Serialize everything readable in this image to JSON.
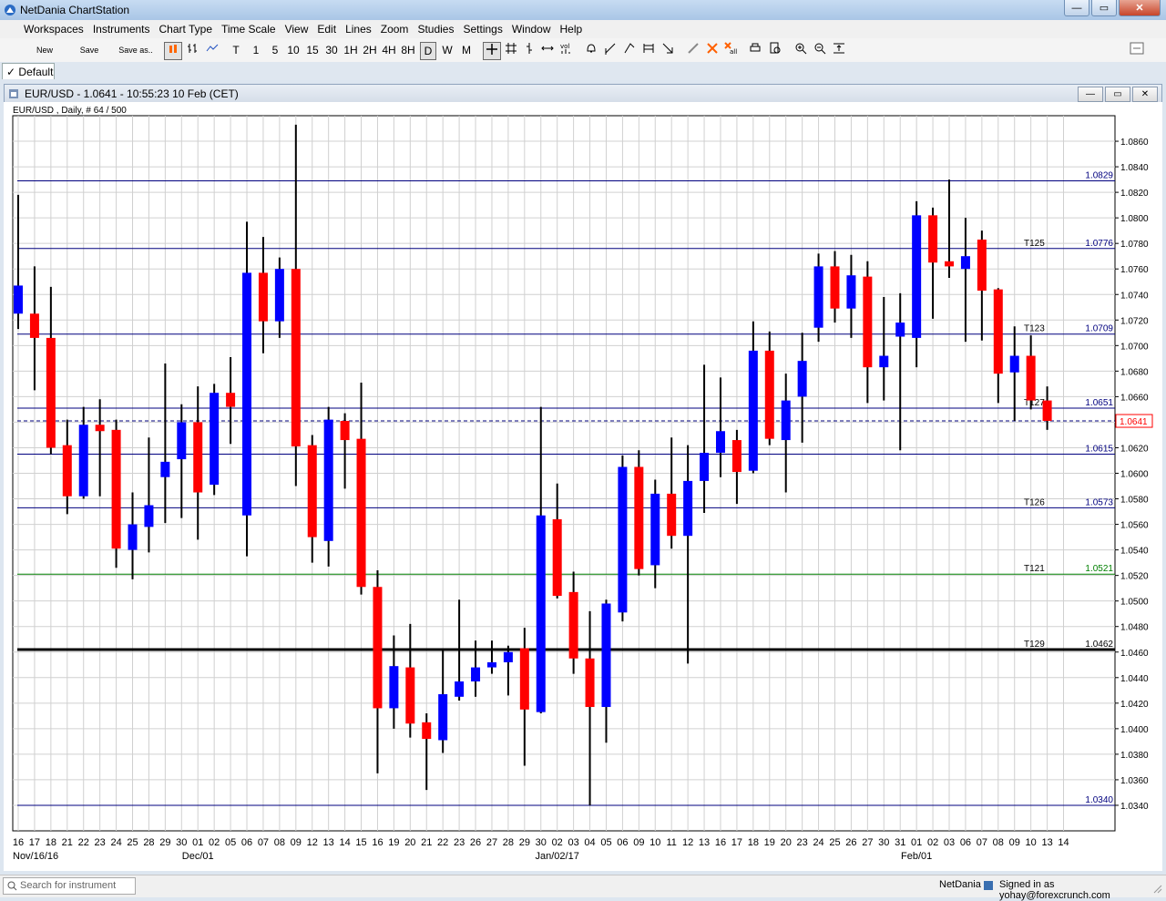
{
  "app": {
    "title": "NetDania ChartStation"
  },
  "window_buttons": [
    "—",
    "▭",
    "✕"
  ],
  "menu": [
    "Workspaces",
    "Instruments",
    "Chart Type",
    "Time Scale",
    "View",
    "Edit",
    "Lines",
    "Zoom",
    "Studies",
    "Settings",
    "Window",
    "Help"
  ],
  "toolbar": {
    "new": "New",
    "save": "Save",
    "save_as": "Save as..",
    "timescales": [
      "T",
      "1",
      "5",
      "10",
      "15",
      "30",
      "1H",
      "2H",
      "4H",
      "8H",
      "D",
      "W",
      "M"
    ],
    "selected_timescale": "D"
  },
  "tab": {
    "label": "Default"
  },
  "doc": {
    "title": "EUR/USD - 1.0641 - 10:55:23  10 Feb (CET)"
  },
  "status": {
    "search_placeholder": "Search for instrument",
    "brand": "NetDania",
    "signed_in": "Signed in as yohay@forexcrunch.com"
  },
  "colors": {
    "up": "#0000ff",
    "down": "#ff0000",
    "wick": "#000000",
    "hline": "#00007f",
    "support": "#008000",
    "bold_line": "#000000",
    "grid": "#d0d0d0"
  },
  "chart_data": {
    "type": "candlestick",
    "subtitle": "EUR/USD , Daily, # 64 / 500",
    "ylim": [
      1.032,
      1.088
    ],
    "yticks": [
      "1.0340",
      "1.0360",
      "1.0380",
      "1.0400",
      "1.0420",
      "1.0440",
      "1.0460",
      "1.0480",
      "1.0500",
      "1.0520",
      "1.0540",
      "1.0560",
      "1.0580",
      "1.0600",
      "1.0620",
      "1.0640",
      "1.0660",
      "1.0680",
      "1.0700",
      "1.0720",
      "1.0740",
      "1.0760",
      "1.0780",
      "1.0800",
      "1.0820",
      "1.0840",
      "1.0860"
    ],
    "day_labels": [
      "16",
      "17",
      "18",
      "21",
      "22",
      "23",
      "24",
      "25",
      "28",
      "29",
      "30",
      "01",
      "02",
      "05",
      "06",
      "07",
      "08",
      "09",
      "12",
      "13",
      "14",
      "15",
      "16",
      "19",
      "20",
      "21",
      "22",
      "23",
      "26",
      "27",
      "28",
      "29",
      "30",
      "02",
      "03",
      "04",
      "05",
      "06",
      "09",
      "10",
      "11",
      "12",
      "13",
      "16",
      "17",
      "18",
      "19",
      "20",
      "23",
      "24",
      "25",
      "26",
      "27",
      "30",
      "31",
      "01",
      "02",
      "03",
      "06",
      "07",
      "08",
      "09",
      "10",
      "13",
      "14"
    ],
    "month_labels": [
      {
        "text": "Nov/16/16",
        "index": 0
      },
      {
        "text": "Dec/01",
        "index": 11
      },
      {
        "text": "Jan/02/17",
        "index": 33
      },
      {
        "text": "Feb/01",
        "index": 55
      }
    ],
    "candles": [
      {
        "o": 1.0725,
        "h": 1.0818,
        "l": 1.0713,
        "c": 1.0747
      },
      {
        "o": 1.0725,
        "h": 1.0762,
        "l": 1.0665,
        "c": 1.0706
      },
      {
        "o": 1.0706,
        "h": 1.0746,
        "l": 1.0615,
        "c": 1.062
      },
      {
        "o": 1.0622,
        "h": 1.0642,
        "l": 1.0568,
        "c": 1.0582
      },
      {
        "o": 1.0582,
        "h": 1.0652,
        "l": 1.058,
        "c": 1.0638
      },
      {
        "o": 1.0638,
        "h": 1.0658,
        "l": 1.0582,
        "c": 1.0633
      },
      {
        "o": 1.0634,
        "h": 1.0642,
        "l": 1.0526,
        "c": 1.0541
      },
      {
        "o": 1.054,
        "h": 1.0585,
        "l": 1.0517,
        "c": 1.056
      },
      {
        "o": 1.0558,
        "h": 1.0628,
        "l": 1.0538,
        "c": 1.0575
      },
      {
        "o": 1.0597,
        "h": 1.0686,
        "l": 1.0561,
        "c": 1.0609
      },
      {
        "o": 1.0611,
        "h": 1.0654,
        "l": 1.0565,
        "c": 1.064
      },
      {
        "o": 1.064,
        "h": 1.0668,
        "l": 1.0548,
        "c": 1.0585
      },
      {
        "o": 1.0591,
        "h": 1.067,
        "l": 1.0583,
        "c": 1.0663
      },
      {
        "o": 1.0663,
        "h": 1.0691,
        "l": 1.0623,
        "c": 1.0652
      },
      {
        "o": 1.0567,
        "h": 1.0797,
        "l": 1.0535,
        "c": 1.0757
      },
      {
        "o": 1.0757,
        "h": 1.0785,
        "l": 1.0694,
        "c": 1.0719
      },
      {
        "o": 1.0719,
        "h": 1.0769,
        "l": 1.0706,
        "c": 1.076
      },
      {
        "o": 1.076,
        "h": 1.0873,
        "l": 1.059,
        "c": 1.0621
      },
      {
        "o": 1.0622,
        "h": 1.063,
        "l": 1.053,
        "c": 1.055
      },
      {
        "o": 1.0547,
        "h": 1.0652,
        "l": 1.0527,
        "c": 1.0642
      },
      {
        "o": 1.0641,
        "h": 1.0647,
        "l": 1.0588,
        "c": 1.0626
      },
      {
        "o": 1.0627,
        "h": 1.0671,
        "l": 1.0505,
        "c": 1.0511
      },
      {
        "o": 1.0511,
        "h": 1.0524,
        "l": 1.0365,
        "c": 1.0416
      },
      {
        "o": 1.0416,
        "h": 1.0473,
        "l": 1.04,
        "c": 1.0449
      },
      {
        "o": 1.0448,
        "h": 1.0482,
        "l": 1.0393,
        "c": 1.0404
      },
      {
        "o": 1.0405,
        "h": 1.0412,
        "l": 1.0352,
        "c": 1.0392
      },
      {
        "o": 1.0391,
        "h": 1.0462,
        "l": 1.0381,
        "c": 1.0427
      },
      {
        "o": 1.0425,
        "h": 1.0501,
        "l": 1.0422,
        "c": 1.0437
      },
      {
        "o": 1.0437,
        "h": 1.0469,
        "l": 1.0425,
        "c": 1.0448
      },
      {
        "o": 1.0448,
        "h": 1.0469,
        "l": 1.0443,
        "c": 1.0452
      },
      {
        "o": 1.0452,
        "h": 1.0465,
        "l": 1.0426,
        "c": 1.046
      },
      {
        "o": 1.0463,
        "h": 1.0479,
        "l": 1.0371,
        "c": 1.0415
      },
      {
        "o": 1.0413,
        "h": 1.0652,
        "l": 1.0412,
        "c": 1.0567
      },
      {
        "o": 1.0564,
        "h": 1.0592,
        "l": 1.0502,
        "c": 1.0504
      },
      {
        "o": 1.0507,
        "h": 1.0523,
        "l": 1.0443,
        "c": 1.0455
      },
      {
        "o": 1.0455,
        "h": 1.0492,
        "l": 1.034,
        "c": 1.0417
      },
      {
        "o": 1.0417,
        "h": 1.0501,
        "l": 1.0389,
        "c": 1.0498
      },
      {
        "o": 1.0491,
        "h": 1.0614,
        "l": 1.0484,
        "c": 1.0605
      },
      {
        "o": 1.0605,
        "h": 1.0618,
        "l": 1.052,
        "c": 1.0525
      },
      {
        "o": 1.0528,
        "h": 1.0595,
        "l": 1.051,
        "c": 1.0584
      },
      {
        "o": 1.0584,
        "h": 1.0628,
        "l": 1.0541,
        "c": 1.0551
      },
      {
        "o": 1.0551,
        "h": 1.0622,
        "l": 1.0451,
        "c": 1.0594
      },
      {
        "o": 1.0594,
        "h": 1.0685,
        "l": 1.0569,
        "c": 1.0616
      },
      {
        "o": 1.0616,
        "h": 1.0675,
        "l": 1.0597,
        "c": 1.0633
      },
      {
        "o": 1.0626,
        "h": 1.0634,
        "l": 1.0576,
        "c": 1.0601
      },
      {
        "o": 1.0602,
        "h": 1.0719,
        "l": 1.06,
        "c": 1.0696
      },
      {
        "o": 1.0696,
        "h": 1.0711,
        "l": 1.0622,
        "c": 1.0627
      },
      {
        "o": 1.0626,
        "h": 1.0678,
        "l": 1.0585,
        "c": 1.0657
      },
      {
        "o": 1.066,
        "h": 1.071,
        "l": 1.0624,
        "c": 1.0688
      },
      {
        "o": 1.0714,
        "h": 1.0772,
        "l": 1.0703,
        "c": 1.0762
      },
      {
        "o": 1.0762,
        "h": 1.0774,
        "l": 1.0718,
        "c": 1.0729
      },
      {
        "o": 1.0729,
        "h": 1.0771,
        "l": 1.0706,
        "c": 1.0755
      },
      {
        "o": 1.0754,
        "h": 1.0766,
        "l": 1.0655,
        "c": 1.0683
      },
      {
        "o": 1.0683,
        "h": 1.0738,
        "l": 1.0657,
        "c": 1.0692
      },
      {
        "o": 1.0707,
        "h": 1.0741,
        "l": 1.0618,
        "c": 1.0718
      },
      {
        "o": 1.0706,
        "h": 1.0813,
        "l": 1.0683,
        "c": 1.0802
      },
      {
        "o": 1.0802,
        "h": 1.0808,
        "l": 1.0721,
        "c": 1.0765
      },
      {
        "o": 1.0766,
        "h": 1.083,
        "l": 1.0753,
        "c": 1.0762
      },
      {
        "o": 1.076,
        "h": 1.08,
        "l": 1.0703,
        "c": 1.077
      },
      {
        "o": 1.0783,
        "h": 1.079,
        "l": 1.0704,
        "c": 1.0743
      },
      {
        "o": 1.0744,
        "h": 1.0745,
        "l": 1.0655,
        "c": 1.0678
      },
      {
        "o": 1.0679,
        "h": 1.0715,
        "l": 1.0641,
        "c": 1.0692
      },
      {
        "o": 1.0692,
        "h": 1.0708,
        "l": 1.065,
        "c": 1.0657
      },
      {
        "o": 1.0657,
        "h": 1.0668,
        "l": 1.0634,
        "c": 1.0641
      }
    ],
    "lines": [
      {
        "value": 1.0829,
        "label": "1.0829",
        "tag": "",
        "style": "thin",
        "color": "#00007f"
      },
      {
        "value": 1.0776,
        "label": "1.0776",
        "tag": "T125",
        "style": "thin",
        "color": "#00007f"
      },
      {
        "value": 1.0709,
        "label": "1.0709",
        "tag": "T123",
        "style": "thin",
        "color": "#00007f"
      },
      {
        "value": 1.0651,
        "label": "1.0651",
        "tag": "T127",
        "style": "thin",
        "color": "#00007f"
      },
      {
        "value": 1.0641,
        "label": "",
        "tag": "",
        "style": "dashed",
        "color": "#00007f"
      },
      {
        "value": 1.0615,
        "label": "1.0615",
        "tag": "",
        "style": "thin",
        "color": "#00007f"
      },
      {
        "value": 1.0573,
        "label": "1.0573",
        "tag": "T126",
        "style": "thin",
        "color": "#00007f"
      },
      {
        "value": 1.0521,
        "label": "1.0521",
        "tag": "T121",
        "style": "thin",
        "color": "#008000"
      },
      {
        "value": 1.0462,
        "label": "1.0462",
        "tag": "T129",
        "style": "bold",
        "color": "#000000"
      },
      {
        "value": 1.034,
        "label": "1.0340",
        "tag": "",
        "style": "thin",
        "color": "#00007f"
      }
    ],
    "current_price_label": "1.0641"
  }
}
